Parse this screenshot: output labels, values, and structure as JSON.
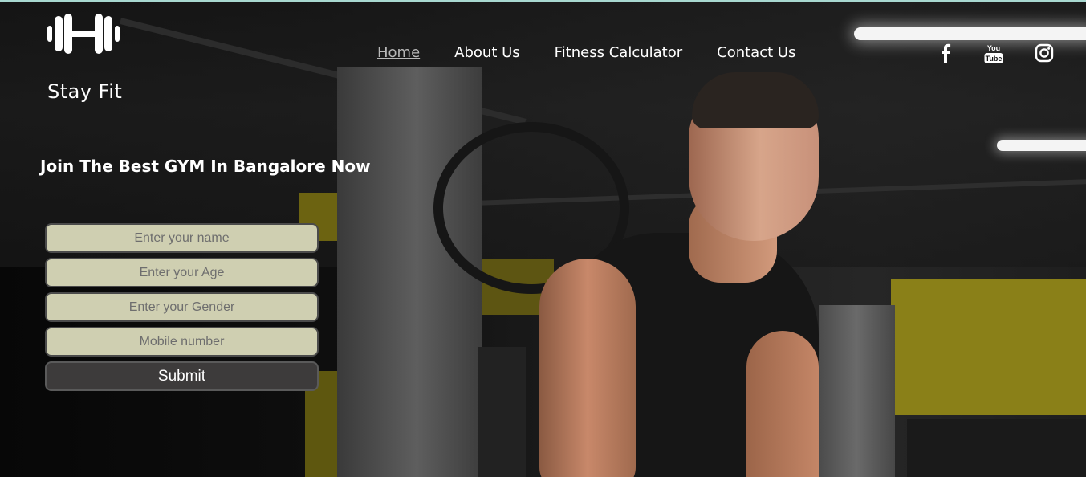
{
  "brand": {
    "name": "Stay Fit",
    "logo_icon": "dumbbell-icon"
  },
  "nav": {
    "items": [
      {
        "label": "Home",
        "active": true
      },
      {
        "label": "About Us",
        "active": false
      },
      {
        "label": "Fitness Calculator",
        "active": false
      },
      {
        "label": "Contact Us",
        "active": false
      }
    ]
  },
  "social": {
    "icons": [
      "facebook-icon",
      "youtube-icon",
      "instagram-icon"
    ],
    "youtube_text_top": "You",
    "youtube_text_bottom": "Tube"
  },
  "hero": {
    "headline": "Join The Best GYM In Bangalore Now"
  },
  "form": {
    "name_placeholder": "Enter your name",
    "age_placeholder": "Enter your Age",
    "gender_placeholder": "Enter your Gender",
    "mobile_placeholder": "Mobile number",
    "submit_label": "Submit"
  },
  "colors": {
    "input_bg": "#cfcfb1",
    "button_bg": "#3d3b3b",
    "top_border": "#a8d8d0"
  }
}
